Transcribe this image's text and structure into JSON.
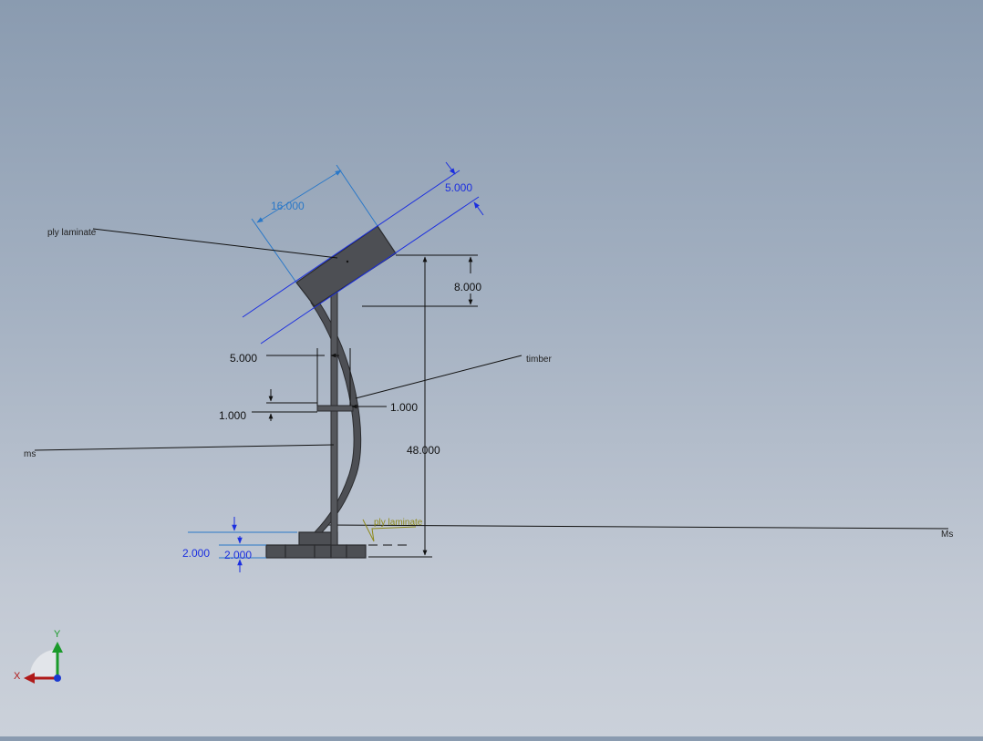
{
  "drawing": {
    "dimensions": {
      "panel_width": "16.000",
      "panel_thickness": "5.000",
      "panel_height": "8.000",
      "post_width": "5.000",
      "bar_thickness_left": "1.000",
      "bar_thickness_right": "1.000",
      "total_height": "48.000",
      "base_upper": "2.000",
      "base_lower": "2.000"
    },
    "notes": {
      "panel_material": "ply laminate",
      "timber": "timber",
      "post_material": "ms",
      "base_material": "ply laminate",
      "ground_material": "Ms"
    }
  },
  "triad": {
    "x_label": "X",
    "y_label": "Y"
  },
  "colors": {
    "dimension_blue": "#1b2ee0",
    "driven_blue": "#2a78c8",
    "part_fill": "#4d4f54",
    "part_stroke": "#2a2b2e",
    "leader": "#1a1a1a",
    "weld_symbol": "#8e8a1c",
    "axis_x": "#b01a1a",
    "axis_y": "#1a9a2a",
    "axis_z": "#1a3ad0"
  }
}
